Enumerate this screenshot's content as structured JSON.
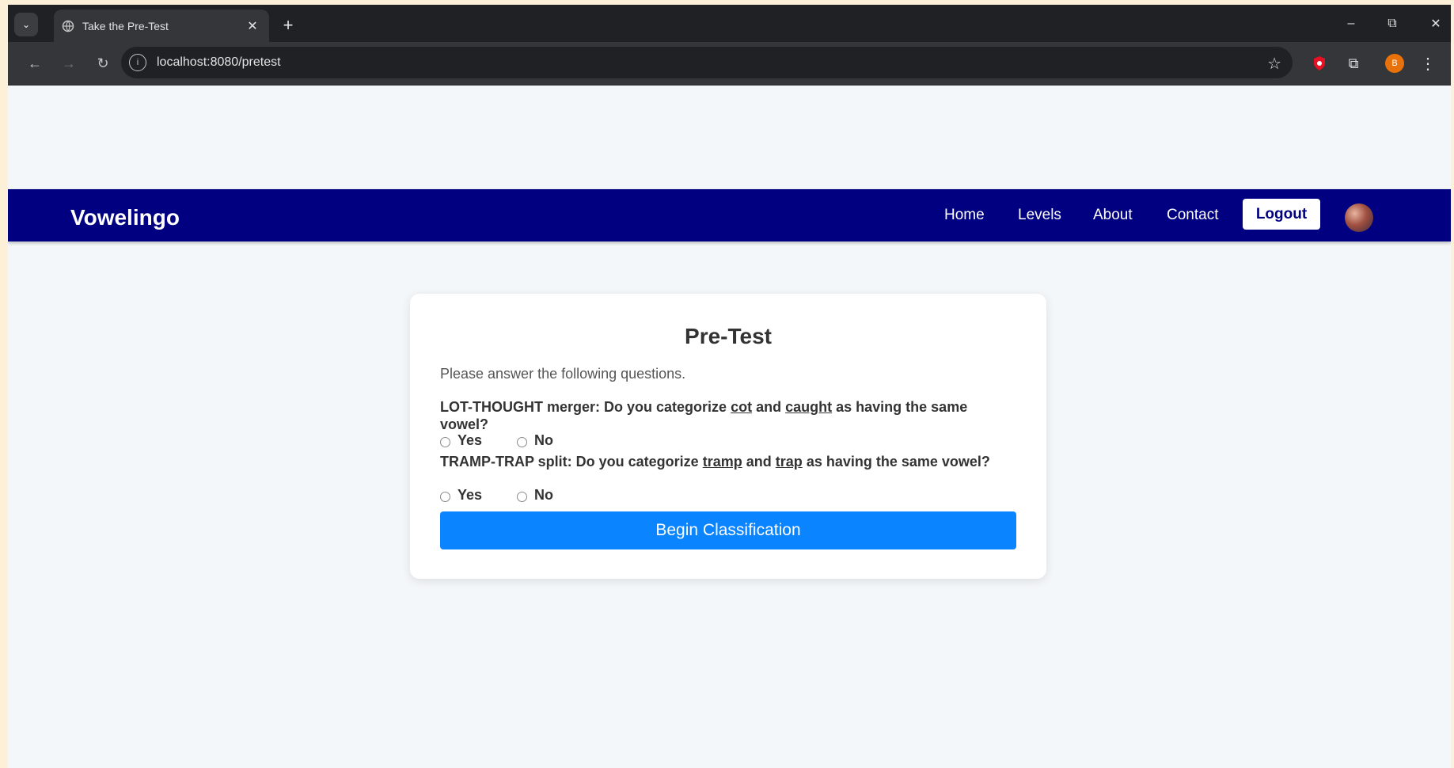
{
  "browser": {
    "tab_title": "Take the Pre-Test",
    "url": "localhost:8080/pretest",
    "profile_initial": "B"
  },
  "navbar": {
    "brand": "Vowelingo",
    "links": [
      "Home",
      "Levels",
      "About",
      "Contact"
    ],
    "logout_label": "Logout"
  },
  "pretest": {
    "title": "Pre-Test",
    "instructions": "Please answer the following questions.",
    "questions": [
      {
        "prefix": "LOT-THOUGHT merger: Do you categorize",
        "word1": "cot",
        "middle": "and",
        "word2": "caught",
        "suffix": "as having the same vowel?",
        "options": [
          "Yes",
          "No"
        ]
      },
      {
        "prefix": "TRAMP-TRAP split: Do you categorize",
        "word1": "tramp",
        "middle": "and",
        "word2": "trap",
        "suffix": "as having the same vowel?",
        "options": [
          "Yes",
          "No"
        ]
      }
    ],
    "submit_label": "Begin Classification"
  },
  "colors": {
    "navbar": "#000080",
    "button": "#0a84ff",
    "page_bg": "#f4f7f9"
  }
}
